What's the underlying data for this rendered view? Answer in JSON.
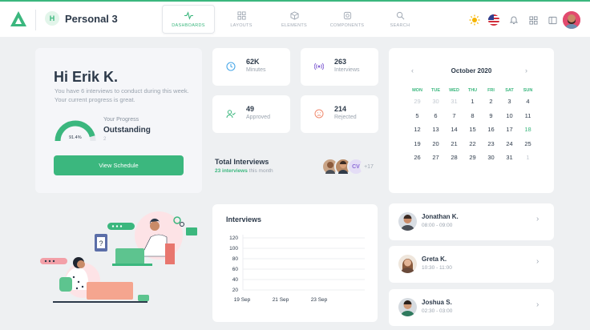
{
  "header": {
    "workspace_initial": "H",
    "workspace_name": "Personal 3",
    "nav": [
      {
        "label": "DASHBOARDS",
        "icon": "pulse-icon",
        "active": true
      },
      {
        "label": "LAYOUTS",
        "icon": "grid-icon"
      },
      {
        "label": "ELEMENTS",
        "icon": "cube-icon"
      },
      {
        "label": "COMPONENTS",
        "icon": "gear-icon"
      },
      {
        "label": "SEARCH",
        "icon": "search-icon"
      }
    ],
    "right_icons": [
      "sun-icon",
      "us-flag-icon",
      "bell-icon",
      "apps-grid-icon",
      "sidebar-toggle-icon",
      "user-avatar"
    ]
  },
  "welcome": {
    "greeting": "Hi Erik K.",
    "description": "You have 6 interviews to conduct during this week. Your current progress is great.",
    "gauge_value": "91.4%",
    "gauge_fraction": 0.914,
    "progress_label": "Your Progress",
    "progress_value": "Outstanding",
    "progress_sub": "2",
    "button": "View Schedule"
  },
  "stats": [
    {
      "value": "62K",
      "label": "Minutes",
      "icon": "clock-icon",
      "color": "#4aa8e8",
      "bg": "#dcecfb"
    },
    {
      "value": "263",
      "label": "Interviews",
      "icon": "broadcast-icon",
      "color": "#8b6bd6",
      "bg": "#ebe5fa"
    },
    {
      "value": "49",
      "label": "Approved",
      "icon": "user-check-icon",
      "color": "#3bb77e",
      "bg": "#e2f5ea"
    },
    {
      "value": "214",
      "label": "Rejected",
      "icon": "frown-icon",
      "color": "#f08a6e",
      "bg": "#fde6df"
    }
  ],
  "total_interviews": {
    "title": "Total Interviews",
    "count_text": "23 interviews",
    "period": "this month",
    "avatar_initials": "CV",
    "more": "+17"
  },
  "calendar": {
    "month": "October 2020",
    "days_of_week": [
      "MON",
      "TUE",
      "WED",
      "THU",
      "FRI",
      "SAT",
      "SUN"
    ],
    "weeks": [
      [
        "29",
        "30",
        "31",
        "1",
        "2",
        "3",
        "4"
      ],
      [
        "5",
        "6",
        "7",
        "8",
        "9",
        "10",
        "11"
      ],
      [
        "12",
        "13",
        "14",
        "15",
        "16",
        "17",
        "18"
      ],
      [
        "19",
        "20",
        "21",
        "22",
        "23",
        "24",
        "25"
      ],
      [
        "26",
        "27",
        "28",
        "29",
        "30",
        "31",
        "1"
      ]
    ],
    "today": "18"
  },
  "chart_data": {
    "type": "line",
    "title": "Interviews",
    "categories": [
      "19 Sep",
      "21 Sep",
      "23 Sep"
    ],
    "ylim": [
      20,
      120
    ],
    "yticks": [
      120,
      100,
      80,
      60,
      40,
      20
    ],
    "xlabel": "",
    "ylabel": "",
    "grid": true,
    "series": []
  },
  "interviews": [
    {
      "name": "Jonathan K.",
      "time": "08:00 - 09:00",
      "skin": "#c98b68",
      "shirt": "#4a4f57"
    },
    {
      "name": "Greta K.",
      "time": "10:30 - 11:00",
      "skin": "#e3b596",
      "shirt": "#6a4a3a"
    },
    {
      "name": "Joshua S.",
      "time": "02:30 - 03:00",
      "skin": "#d09a78",
      "shirt": "#2f7a5e"
    }
  ],
  "colors": {
    "accent": "#3bb77e",
    "background": "#eef0f2",
    "card": "#ffffff"
  }
}
